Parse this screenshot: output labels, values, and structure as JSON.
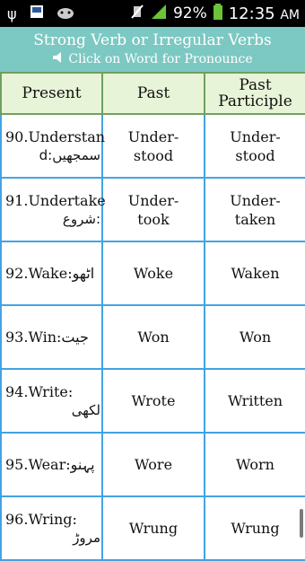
{
  "status": {
    "battery": "92%",
    "time": "12:35",
    "ampm": "AM"
  },
  "header": {
    "title": "Strong Verb or Irregular Verbs",
    "subtitle": "Click on Word for Pronounce"
  },
  "table": {
    "columns": [
      "Present",
      "Past",
      "Past Participle"
    ],
    "rows": [
      {
        "present": "90.Understan",
        "urdu": "d:سمجھیں",
        "past": "Under-\nstood",
        "participle": "Under-\nstood"
      },
      {
        "present": "91.Undertake",
        "urdu": "شروع:",
        "past": "Under-\ntook",
        "participle": "Under-\ntaken"
      },
      {
        "present": "92.Wake:",
        "urdu": "اٹھو",
        "past": "Woke",
        "participle": "Waken"
      },
      {
        "present": "93.Win:",
        "urdu": "جیت",
        "past": "Won",
        "participle": "Won"
      },
      {
        "present": "94.Write:",
        "urdu": "لکھی",
        "past": "Wrote",
        "participle": "Written"
      },
      {
        "present": "95.Wear:",
        "urdu": "پہنو",
        "past": "Wore",
        "participle": "Worn"
      },
      {
        "present": "96.Wring:",
        "urdu": "مروڑ",
        "past": "Wrung",
        "participle": "Wrung"
      }
    ]
  }
}
